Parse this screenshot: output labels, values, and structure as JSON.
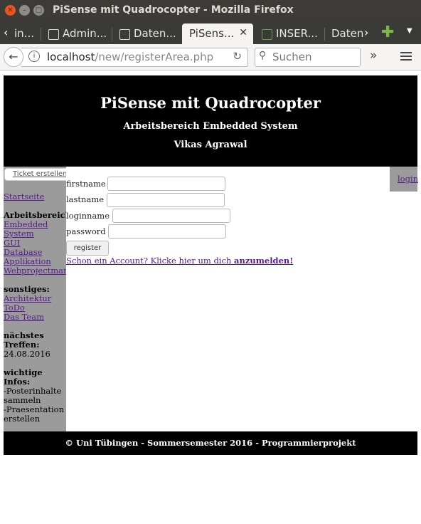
{
  "window": {
    "title": "PiSense mit Quadrocopter - Mozilla Firefox"
  },
  "tabs": [
    {
      "label": "in..."
    },
    {
      "label": "Admin..."
    },
    {
      "label": "Daten..."
    },
    {
      "label": "PiSens...",
      "active": true
    },
    {
      "label": "INSER..."
    },
    {
      "label": "Daten"
    }
  ],
  "nav": {
    "url_host": "localhost",
    "url_path": "/new/registerArea.php",
    "search_placeholder": "Suchen"
  },
  "header": {
    "title": "PiSense mit Quadrocopter",
    "subtitle": "Arbeitsbereich Embedded System",
    "author": "Vikas Agrawal"
  },
  "sidebar": {
    "ticket_button": "Ticket erstellen",
    "home": "Startseite",
    "area_heading": "Arbeitsbereich",
    "areas": [
      "Embedded",
      "System",
      "GUI",
      "Database",
      "Applikation",
      "Webprojectman"
    ],
    "other_heading": "sonstiges:",
    "other": [
      "Architektur",
      "ToDo",
      "Das Team"
    ],
    "next_heading_1": "nächstes",
    "next_heading_2": "Treffen:",
    "next_date": "24.08.2016",
    "info_heading_1": "wichtige",
    "info_heading_2": "Infos:",
    "info_lines": [
      "-Posterinhalte",
      "sammeln",
      "-Praesentation",
      "erstellen"
    ]
  },
  "login_link": "login",
  "form": {
    "firstname_label": "firstname",
    "lastname_label": "lastname",
    "loginname_label": "loginname",
    "password_label": "password",
    "register_button": "register",
    "account_text": "Schon ein Account? Klicke hier um dich ",
    "account_link": "anzumelden!"
  },
  "footer": {
    "text": "© Uni Tübingen - Sommersemester 2016 - Programmierprojekt"
  }
}
